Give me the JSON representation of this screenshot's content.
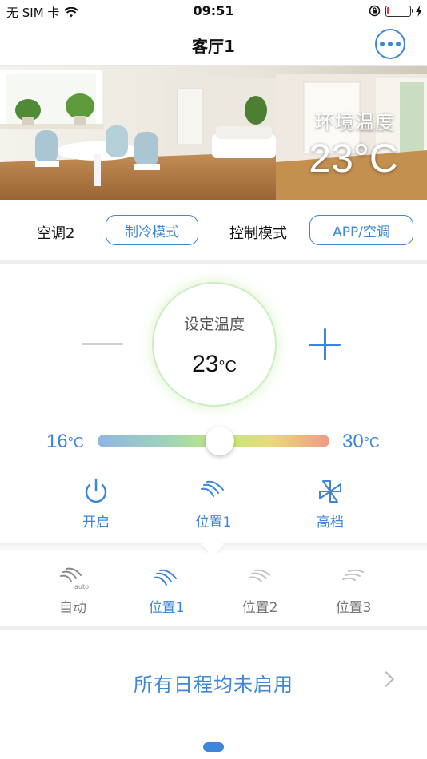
{
  "status_bar": {
    "carrier": "无 SIM 卡",
    "time": "09:51",
    "battery_level": 0.1,
    "battery_color": "#e53935"
  },
  "nav": {
    "title": "客厅1",
    "more_icon": "more-dots-icon"
  },
  "hero": {
    "env_label": "环境温度",
    "env_temp": "23°C"
  },
  "mode_row": {
    "ac_name": "空调2",
    "mode_button": "制冷模式",
    "control_label": "控制模式",
    "control_button": "APP/空调"
  },
  "temperature": {
    "set_label": "设定温度",
    "set_value": "23",
    "set_unit": "°C",
    "min_value": "16",
    "min_unit": "°C",
    "max_value": "30",
    "max_unit": "°C",
    "slider_value": 23,
    "slider_min": 16,
    "slider_max": 30
  },
  "controls": [
    {
      "label": "开启",
      "icon": "power-icon"
    },
    {
      "label": "位置1",
      "icon": "swing-position-icon"
    },
    {
      "label": "高档",
      "icon": "fan-icon"
    }
  ],
  "swing_positions": [
    {
      "label": "自动",
      "icon": "swing-auto-icon",
      "selected": false,
      "sub_label": "auto"
    },
    {
      "label": "位置1",
      "icon": "swing-position-1-icon",
      "selected": true
    },
    {
      "label": "位置2",
      "icon": "swing-position-2-icon",
      "selected": false
    },
    {
      "label": "位置3",
      "icon": "swing-position-3-icon",
      "selected": false
    }
  ],
  "schedule": {
    "text": "所有日程均未启用"
  },
  "colors": {
    "accent": "#3d86d9",
    "inactive": "#888888"
  }
}
